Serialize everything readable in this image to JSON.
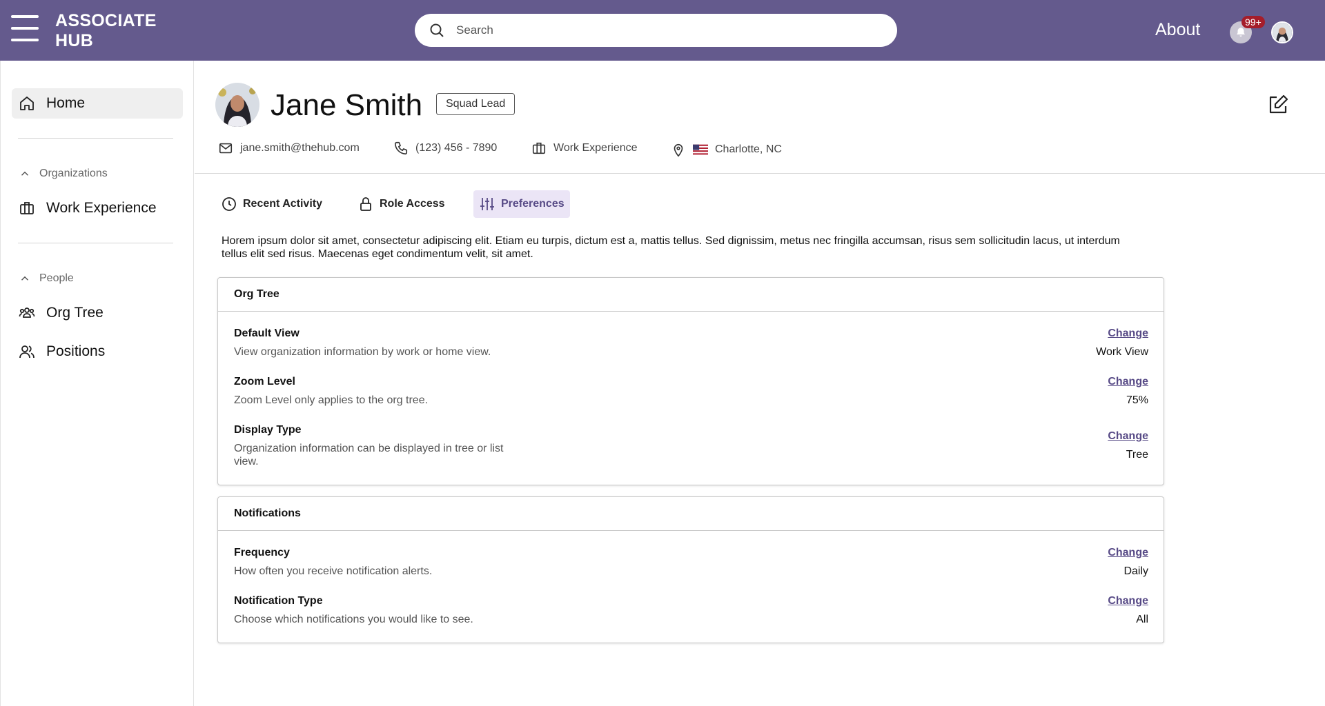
{
  "app": {
    "brand_line1": "ASSOCIATE",
    "brand_line2": "HUB",
    "search_placeholder": "Search",
    "about_label": "About",
    "notification_count": "99+",
    "colors": {
      "header": "#645a8d",
      "accent": "#574a86",
      "tab_active_bg": "#ebe5f6",
      "badge": "#a51d2a"
    }
  },
  "sidebar": {
    "home_label": "Home",
    "organizations_label": "Organizations",
    "work_experience_label": "Work Experience",
    "people_label": "People",
    "org_tree_label": "Org Tree",
    "positions_label": "Positions"
  },
  "profile": {
    "name": "Jane Smith",
    "role": "Squad Lead",
    "email": "jane.smith@thehub.com",
    "phone": "(123) 456 - 7890",
    "work_experience": "Work Experience",
    "location": "Charlotte, NC"
  },
  "tabs": {
    "recent_activity": "Recent Activity",
    "role_access": "Role Access",
    "preferences": "Preferences",
    "active": "preferences"
  },
  "intro_text": "Horem ipsum dolor sit amet, consectetur adipiscing elit. Etiam eu turpis, dictum est a, mattis tellus. Sed dignissim, metus nec fringilla accumsan, risus sem sollicitudin lacus, ut interdum tellus elit sed risus. Maecenas eget condimentum velit, sit amet.",
  "org_tree": {
    "title": "Org Tree",
    "settings": [
      {
        "title": "Default View",
        "desc": "View organization information by work or home view.",
        "change": "Change",
        "value": "Work View"
      },
      {
        "title": "Zoom Level",
        "desc": "Zoom Level only applies to the org tree.",
        "change": "Change",
        "value": "75%"
      },
      {
        "title": "Display Type",
        "desc": "Organization information can be displayed in tree or list view.",
        "change": "Change",
        "value": "Tree"
      }
    ]
  },
  "notifications": {
    "title": "Notifications",
    "settings": [
      {
        "title": "Frequency",
        "desc": "How often you receive notification alerts.",
        "change": "Change",
        "value": "Daily"
      },
      {
        "title": "Notification Type",
        "desc": "Choose which notifications you would like to see.",
        "change": "Change",
        "value": "All"
      }
    ]
  }
}
